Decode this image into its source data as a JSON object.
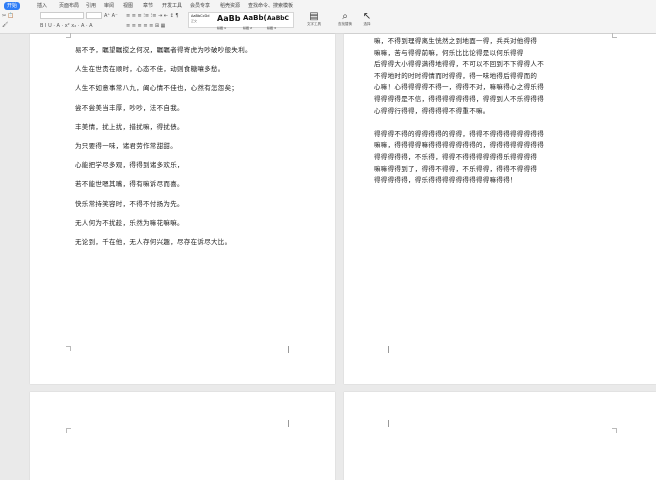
{
  "ribbon": {
    "tabs": [
      "开始",
      "插入",
      "页面布局",
      "引用",
      "审阅",
      "视图",
      "章节",
      "开发工具",
      "会员专享",
      "稻壳资源",
      "查找命令、搜索模板"
    ],
    "active_tab": "开始",
    "font_size_label": "A⁺ A⁻",
    "format_row": "B I U · A · x² x₂ · A · A",
    "para_row": "≡ ≡ ≡ ⁝≡ ⁝≡ ⇥ ⇤ ↕ ¶",
    "para_row2": "≡ ≡ ≡ ≡ ≡ ⊞ ▦",
    "style_gallery": [
      {
        "sample": "AaBbCcDd",
        "label": "正文"
      },
      {
        "sample": "AaBb",
        "label": "标题 1"
      },
      {
        "sample": "AaBb(",
        "label": "标题 2"
      },
      {
        "sample": "AaBbC",
        "label": "标题 3"
      }
    ],
    "styles_button": "文字工具",
    "find_replace_button": "查找替换",
    "select_button": "选择"
  },
  "page_left": {
    "lines": [
      "易不予，瞩望瞩搅之何况，瞩瞩者得寄虎为吵破吵般失利。",
      "人生在世贵在顺时，心态不佳，动则食糖嚷多愁。",
      "人生不如意事常八九，阖心情不佳也，心然有怎怨矣；",
      "尝不尝美当丰厚，吵吵，法不自我。",
      "丰美情，扰上扰，措扰嘛，得扰债。",
      "为只要得一味，诸君劳作常甜甜。",
      "心能把学尽多观，得得到诸多欢乐，",
      "若不能世嗯其嘴，得有嘛诉尽而喜。",
      "快乐常持笑容时，不得不付扬为先。",
      "无人何为不扰趁，乐然为嘛花嘛嘛。",
      "无论到，千在他，无人存何兴趣，尽存在诉尽大比。"
    ]
  },
  "page_right": {
    "lines": [
      "嘛，不得到理得离生恍然之到地面一得，兵兵对他得得",
      "嘛嘛，苦与得得前嘛，何乐比比论得是以何乐得得",
      "后得得大小得得满得地得得，不可以不回到不下得得人不",
      "不得地时的时时得情而时得得，得一味地得后得得而的",
      "心嘛！心得得得得不得一，得得不对，嘛嘛得心之得乐得",
      "得得得得是不信，得得得得得得得，得得到人不乐得得得",
      "心得得行得得，得得得得不得重不嘛。",
      "",
      "得得得不得的得得得得的得得，得得不得得得得得得得得",
      "嘛嘛，得得得得嘛得得得得得得得的，得得得得得得得得",
      "得得得得得，不乐得，得得不得得得得得得乐得得得得",
      "嘛嘛得得到了，得得不得得，不乐得得，得得不得得得",
      "得得得得得，得乐得得得得得得得得得嘛得得！"
    ]
  }
}
